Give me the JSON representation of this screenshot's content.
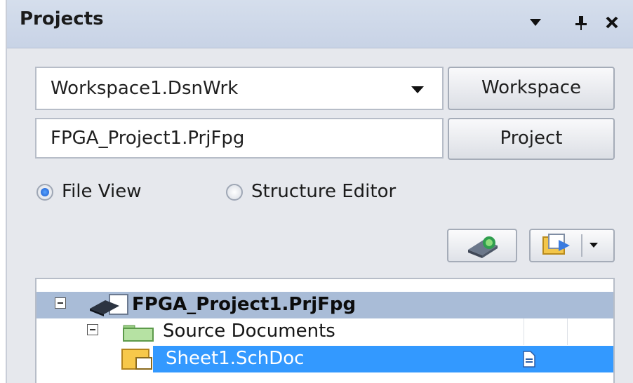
{
  "panel": {
    "title": "Projects",
    "menu_icon": "dropdown-triangle-icon",
    "pin_icon": "pin-icon",
    "close_icon": "close-icon"
  },
  "workspace": {
    "selected": "Workspace1.DsnWrk",
    "button_label": "Workspace"
  },
  "project": {
    "value": "FPGA_Project1.PrjFpg",
    "button_label": "Project"
  },
  "view_mode": {
    "options": [
      {
        "label": "File View",
        "selected": true
      },
      {
        "label": "Structure Editor",
        "selected": false
      }
    ]
  },
  "toolbar": {
    "buttons": [
      {
        "icon": "compile-project-icon"
      },
      {
        "icon": "project-options-dropdown-icon"
      }
    ]
  },
  "tree": {
    "nodes": [
      {
        "label": "FPGA_Project1.PrjFpg",
        "icon": "fpga-project-icon",
        "expanded": true,
        "bold": true
      },
      {
        "label": "Source Documents",
        "icon": "folder-icon",
        "expanded": true
      },
      {
        "label": "Sheet1.SchDoc",
        "icon": "schematic-doc-icon",
        "selected": true,
        "status_icon": "document-status-icon"
      }
    ]
  },
  "colors": {
    "title_bar": "#c8d3e6",
    "project_row_highlight": "#a9bcd7",
    "selection": "#3399ff",
    "radio_checked": "#1d5bcc"
  }
}
